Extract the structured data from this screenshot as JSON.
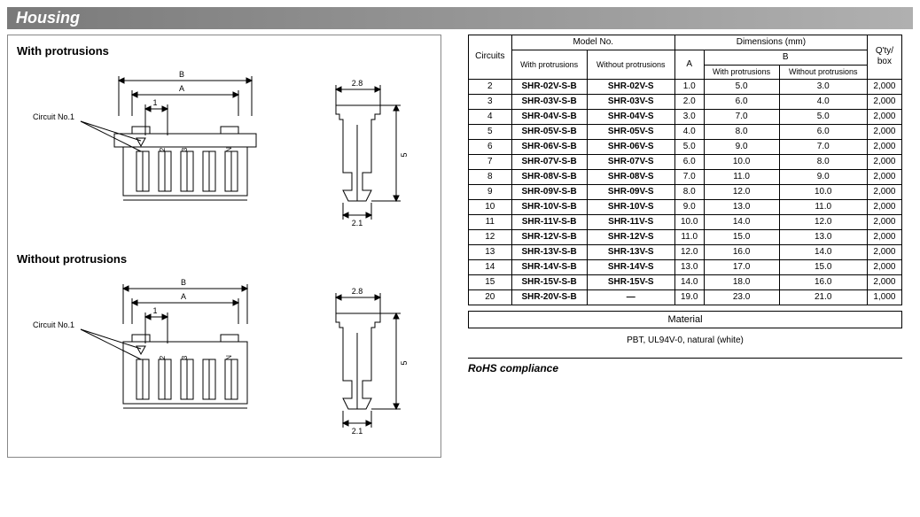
{
  "title": "Housing",
  "headings": {
    "with": "With protrusions",
    "without": "Without protrusions"
  },
  "drawing": {
    "circuit_label": "Circuit No.1",
    "dim_a": "A",
    "dim_b": "B",
    "pitch": "1",
    "pins": [
      "2",
      "3",
      "N"
    ],
    "side_w": "2.8",
    "side_h": "5",
    "side_bot": "2.1"
  },
  "table": {
    "headers": {
      "circuits": "Circuits",
      "model_no": "Model No.",
      "with_prot": "With protrusions",
      "without_prot": "Without protrusions",
      "dimensions": "Dimensions (mm)",
      "a": "A",
      "b": "B",
      "qty": "Q'ty/\nbox"
    },
    "rows": [
      {
        "c": "2",
        "mw": "SHR-02V-S-B",
        "mo": "SHR-02V-S",
        "a": "1.0",
        "bw": "5.0",
        "bo": "3.0",
        "q": "2,000"
      },
      {
        "c": "3",
        "mw": "SHR-03V-S-B",
        "mo": "SHR-03V-S",
        "a": "2.0",
        "bw": "6.0",
        "bo": "4.0",
        "q": "2,000"
      },
      {
        "c": "4",
        "mw": "SHR-04V-S-B",
        "mo": "SHR-04V-S",
        "a": "3.0",
        "bw": "7.0",
        "bo": "5.0",
        "q": "2,000"
      },
      {
        "c": "5",
        "mw": "SHR-05V-S-B",
        "mo": "SHR-05V-S",
        "a": "4.0",
        "bw": "8.0",
        "bo": "6.0",
        "q": "2,000"
      },
      {
        "c": "6",
        "mw": "SHR-06V-S-B",
        "mo": "SHR-06V-S",
        "a": "5.0",
        "bw": "9.0",
        "bo": "7.0",
        "q": "2,000"
      },
      {
        "c": "7",
        "mw": "SHR-07V-S-B",
        "mo": "SHR-07V-S",
        "a": "6.0",
        "bw": "10.0",
        "bo": "8.0",
        "q": "2,000"
      },
      {
        "c": "8",
        "mw": "SHR-08V-S-B",
        "mo": "SHR-08V-S",
        "a": "7.0",
        "bw": "11.0",
        "bo": "9.0",
        "q": "2,000"
      },
      {
        "c": "9",
        "mw": "SHR-09V-S-B",
        "mo": "SHR-09V-S",
        "a": "8.0",
        "bw": "12.0",
        "bo": "10.0",
        "q": "2,000"
      },
      {
        "c": "10",
        "mw": "SHR-10V-S-B",
        "mo": "SHR-10V-S",
        "a": "9.0",
        "bw": "13.0",
        "bo": "11.0",
        "q": "2,000"
      },
      {
        "c": "11",
        "mw": "SHR-11V-S-B",
        "mo": "SHR-11V-S",
        "a": "10.0",
        "bw": "14.0",
        "bo": "12.0",
        "q": "2,000"
      },
      {
        "c": "12",
        "mw": "SHR-12V-S-B",
        "mo": "SHR-12V-S",
        "a": "11.0",
        "bw": "15.0",
        "bo": "13.0",
        "q": "2,000"
      },
      {
        "c": "13",
        "mw": "SHR-13V-S-B",
        "mo": "SHR-13V-S",
        "a": "12.0",
        "bw": "16.0",
        "bo": "14.0",
        "q": "2,000"
      },
      {
        "c": "14",
        "mw": "SHR-14V-S-B",
        "mo": "SHR-14V-S",
        "a": "13.0",
        "bw": "17.0",
        "bo": "15.0",
        "q": "2,000"
      },
      {
        "c": "15",
        "mw": "SHR-15V-S-B",
        "mo": "SHR-15V-S",
        "a": "14.0",
        "bw": "18.0",
        "bo": "16.0",
        "q": "2,000"
      },
      {
        "c": "20",
        "mw": "SHR-20V-S-B",
        "mo": "—",
        "a": "19.0",
        "bw": "23.0",
        "bo": "21.0",
        "q": "1,000"
      }
    ]
  },
  "material": {
    "heading": "Material",
    "text": "PBT, UL94V-0, natural (white)"
  },
  "rohs": "RoHS compliance"
}
